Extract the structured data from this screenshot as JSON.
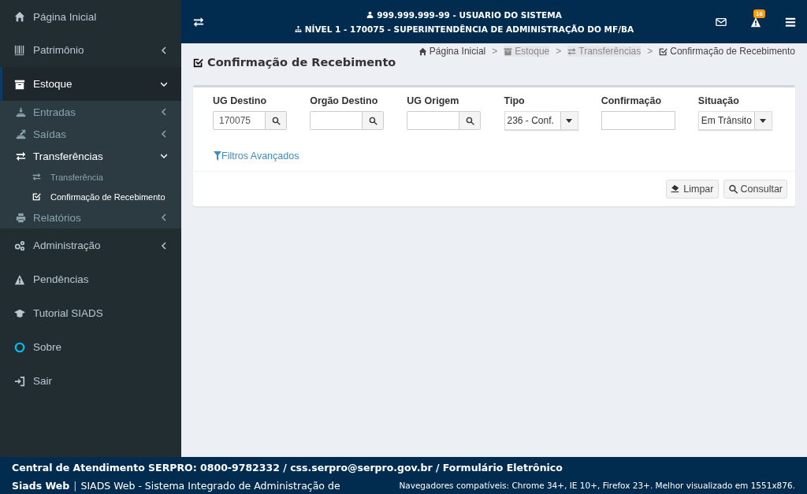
{
  "sidebar": {
    "items": [
      {
        "label": "Página Inicial",
        "selected": false
      },
      {
        "label": "Patrimônio",
        "selected": false,
        "expanded": false
      },
      {
        "label": "Estoque",
        "selected": true,
        "expanded": true,
        "children": [
          {
            "label": "Entradas",
            "selected": false,
            "expanded": false
          },
          {
            "label": "Saídas",
            "selected": false,
            "expanded": false
          },
          {
            "label": "Transferências",
            "selected": true,
            "expanded": true,
            "children": [
              {
                "label": "Transferência",
                "selected": false
              },
              {
                "label": "Confirmação de Recebimento",
                "selected": true
              }
            ]
          },
          {
            "label": "Relatórios",
            "selected": false,
            "expanded": false
          }
        ]
      },
      {
        "label": "Administração",
        "selected": false,
        "expanded": false
      },
      {
        "label": "Pendências",
        "selected": false
      },
      {
        "label": "Tutorial SIADS",
        "selected": false
      },
      {
        "label": "Sobre",
        "selected": false
      },
      {
        "label": "Sair",
        "selected": false
      }
    ]
  },
  "header": {
    "user": "999.999.999-99 - USUARIO DO SISTEMA",
    "unit": "NÍVEL 1 - 170075 - SUPERINTENDÊNCIA DE ADMINISTRAÇÃO DO MF/BA",
    "alerts_badge": "16"
  },
  "page": {
    "title": "Confirmação de Recebimento",
    "breadcrumb": [
      {
        "label": "Página Inicial",
        "disabled": false
      },
      {
        "separator": ">",
        "label": "Estoque",
        "disabled": true
      },
      {
        "separator": ">",
        "label": "Transferências",
        "disabled": true
      },
      {
        "separator": ">",
        "label": "Confirmação de Recebimento",
        "disabled": false
      }
    ],
    "filters": [
      {
        "label": "UG Destino",
        "kind": "lookup",
        "value": "170075"
      },
      {
        "label": "Orgão Destino",
        "kind": "lookup"
      },
      {
        "label": "UG Origem",
        "kind": "lookup"
      },
      {
        "label": "Tipo",
        "kind": "select",
        "value": "236 - Conf."
      },
      {
        "label": "Confirmação",
        "kind": "text"
      },
      {
        "label": "Situação",
        "kind": "select",
        "value": "Em Trânsito"
      }
    ],
    "advanced_filters_link": "Filtros Avançados",
    "buttons": [
      "Limpar",
      "Consultar"
    ]
  },
  "footer": {
    "contact": "Central de Atendimento SERPRO: 0800-9782332 / css.serpro@serpro.gov.br / Formulário Eletrônico",
    "brand": "Siads Web",
    "separator": "|",
    "system": "SIADS Web - Sistema Integrado de Administração de",
    "browsers": "Navegadores compatíveis: Chrome 34+, IE 10+, Firefox 23+. Melhor visualizado em 1551x876."
  }
}
